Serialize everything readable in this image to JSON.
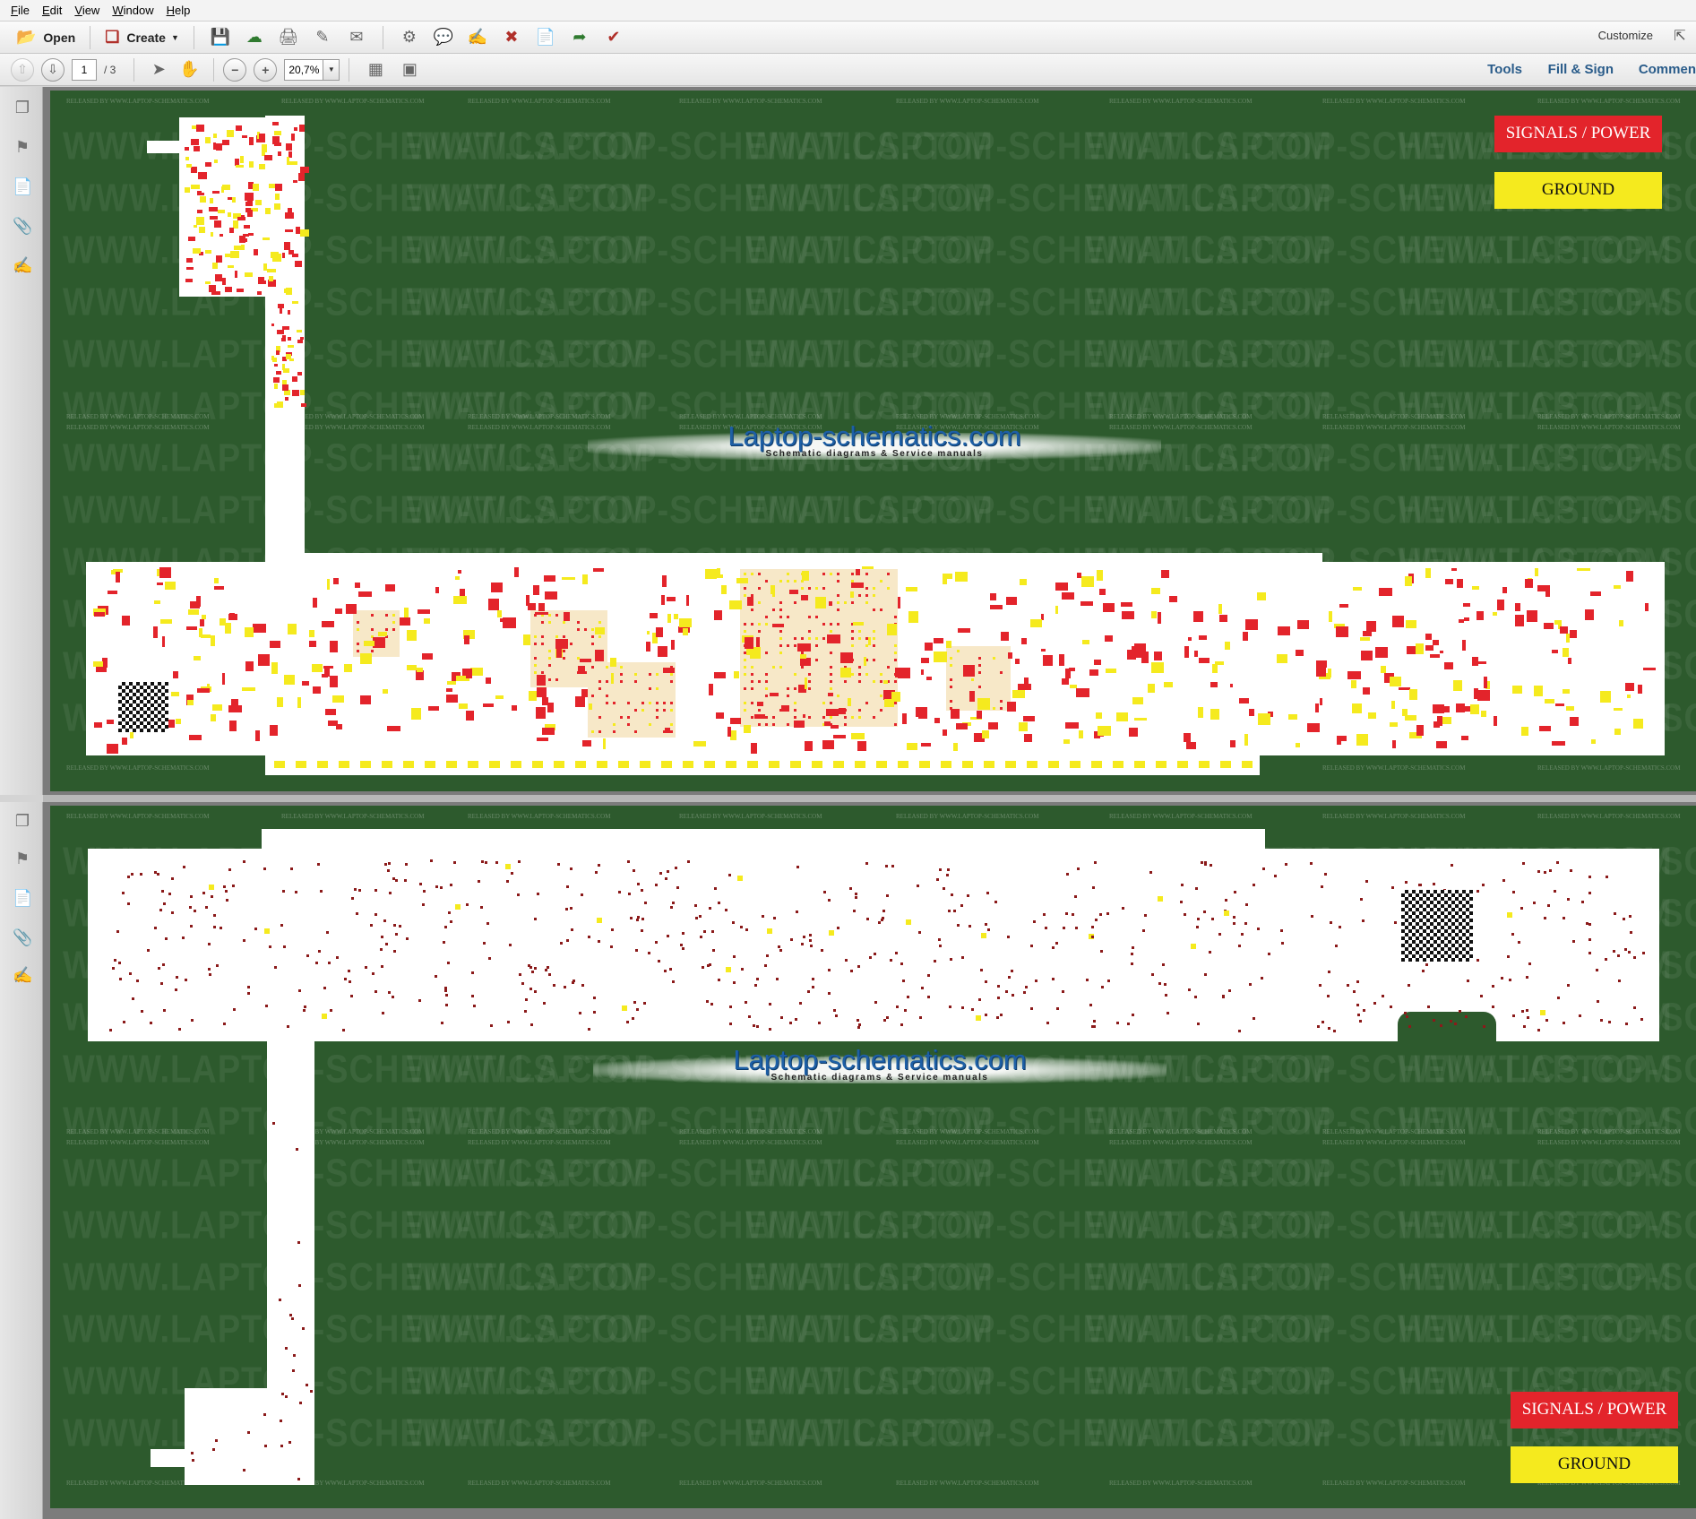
{
  "menu": [
    {
      "label": "File"
    },
    {
      "label": "Edit"
    },
    {
      "label": "View"
    },
    {
      "label": "Window"
    },
    {
      "label": "Help"
    }
  ],
  "toolbar": {
    "open_label": "Open",
    "create_label": "Create",
    "customize_label": "Customize",
    "icons": [
      "save-icon",
      "upload-icon",
      "print-icon",
      "edit-icon",
      "email-icon",
      "gear-icon",
      "comment-icon",
      "sign-icon",
      "pdf-delete-icon",
      "pdf-extract-icon",
      "pdf-export-icon",
      "pdf-redact-icon"
    ]
  },
  "nav": {
    "page_current": "1",
    "page_total": "/ 3",
    "zoom": "20,7%",
    "tools_label": "Tools",
    "fill_sign_label": "Fill & Sign",
    "comment_label": "Commen"
  },
  "document": {
    "watermark_big": "WWW.LAPTOP-SCHEMATICS.COM",
    "watermark_small": "RELEASED BY WWW.LAPTOP-SCHEMATICS.COM",
    "logo_main": "Laptop-schematics.com",
    "logo_sub": "Schematic diagrams & Service manuals",
    "legend_signals": "SIGNALS / POWER",
    "legend_ground": "GROUND"
  },
  "colors": {
    "pcb_background": "#2d5a2d",
    "signals_power": "#e3242b",
    "ground": "#f5ea1e",
    "link": "#2a5c8a"
  }
}
